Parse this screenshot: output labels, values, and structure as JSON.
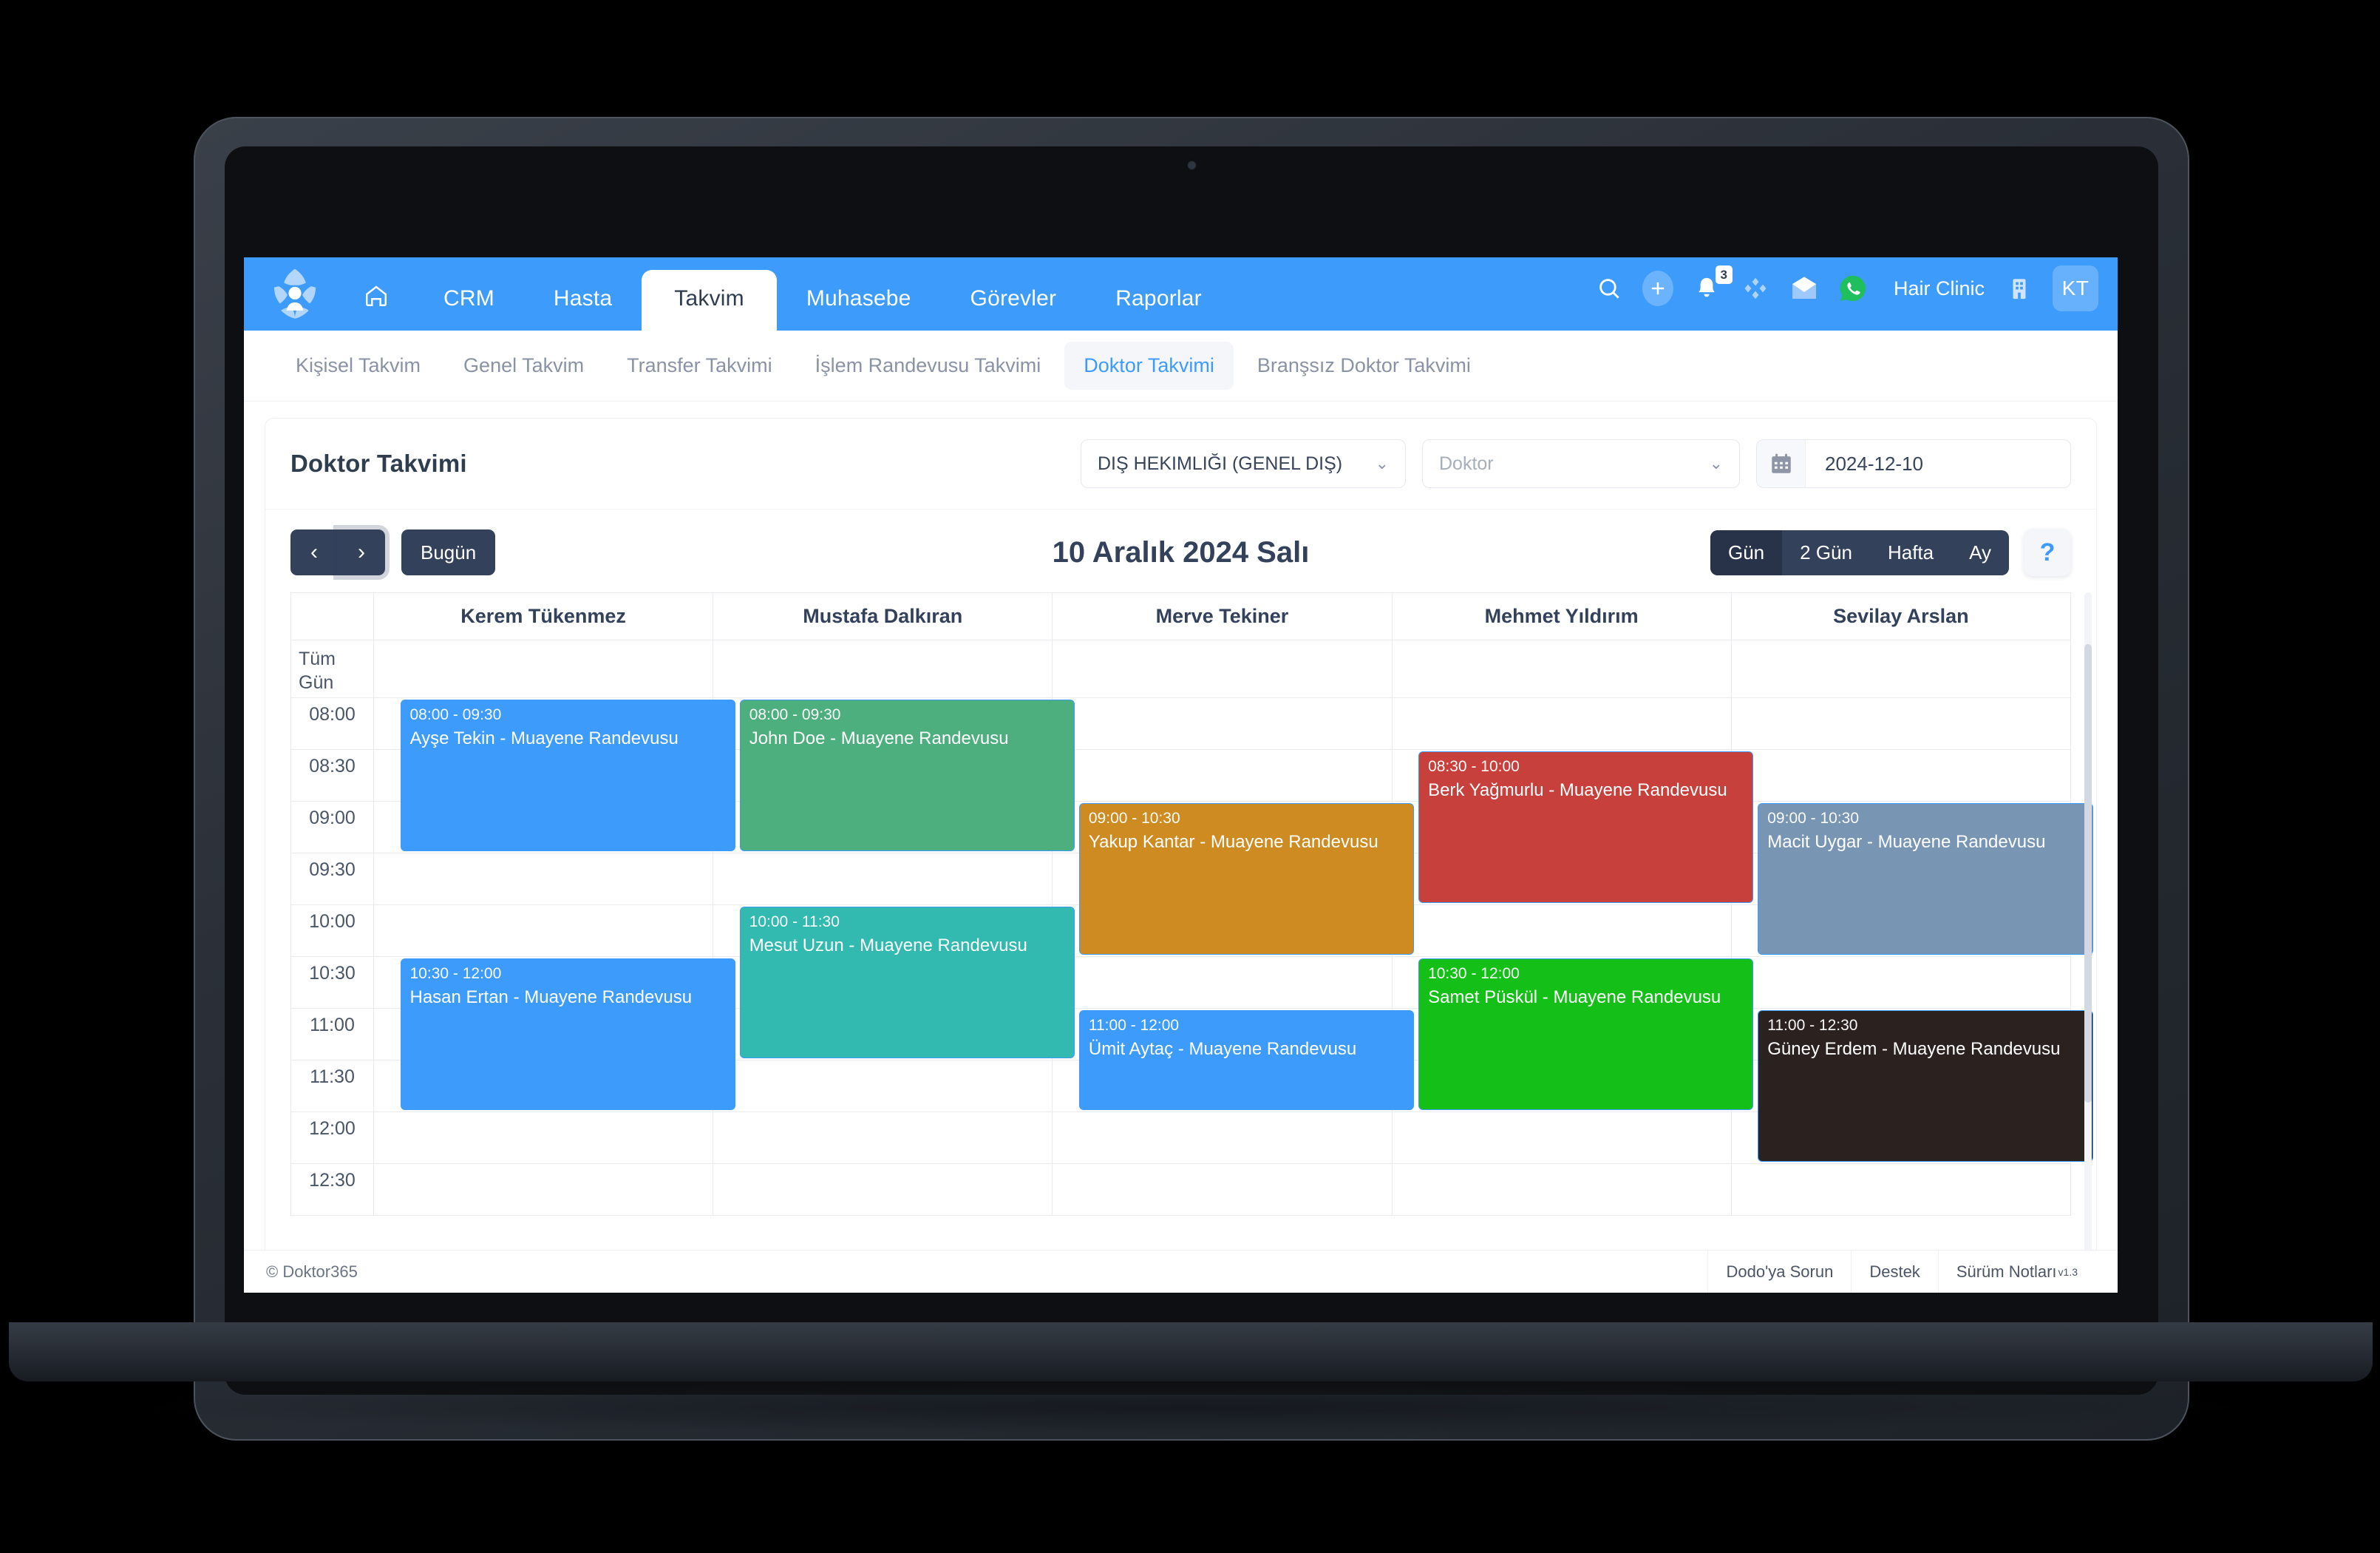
{
  "topnav": {
    "logo_name": "doktor365-logo",
    "items": [
      {
        "label": "",
        "icon": "home-icon",
        "active": false
      },
      {
        "label": "CRM",
        "active": false
      },
      {
        "label": "Hasta",
        "active": false
      },
      {
        "label": "Takvim",
        "active": true
      },
      {
        "label": "Muhasebe",
        "active": false
      },
      {
        "label": "Görevler",
        "active": false
      },
      {
        "label": "Raporlar",
        "active": false
      }
    ],
    "right": {
      "search_icon": "search-icon",
      "add_icon": "plus-icon",
      "bell_icon": "bell-icon",
      "bell_badge": "3",
      "apps_icon": "apps-diamond-icon",
      "mail_icon": "mail-icon",
      "whatsapp_icon": "whatsapp-icon",
      "clinic": "Hair Clinic",
      "building_icon": "building-icon",
      "avatar": "KT"
    },
    "accent": "#3d9bfc"
  },
  "subnav": {
    "items": [
      {
        "label": "Kişisel Takvim",
        "active": false
      },
      {
        "label": "Genel Takvim",
        "active": false
      },
      {
        "label": "Transfer Takvimi",
        "active": false
      },
      {
        "label": "İşlem Randevusu Takvimi",
        "active": false
      },
      {
        "label": "Doktor Takvimi",
        "active": true
      },
      {
        "label": "Branşsız Doktor Takvimi",
        "active": false
      }
    ]
  },
  "card": {
    "title": "Doktor Takvimi",
    "branch_select": "DIŞ HEKIMLIĞI (GENEL DIŞ)",
    "doctor_select_placeholder": "Doktor",
    "date_value": "2024-12-10",
    "calendar_icon": "calendar-icon"
  },
  "toolbar": {
    "prev_icon": "chevron-left-icon",
    "next_icon": "chevron-right-icon",
    "today_label": "Bugün",
    "date_title": "10 Aralık 2024 Salı",
    "views": [
      {
        "label": "Gün",
        "active": true
      },
      {
        "label": "2 Gün",
        "active": false
      },
      {
        "label": "Hafta",
        "active": false
      },
      {
        "label": "Ay",
        "active": false
      }
    ],
    "help_label": "?"
  },
  "calendar": {
    "allday_label_line1": "Tüm",
    "allday_label_line2": "Gün",
    "columns": [
      "Kerem Tükenmez",
      "Mustafa Dalkıran",
      "Merve Tekiner",
      "Mehmet Yıldırım",
      "Sevilay Arslan"
    ],
    "times": [
      "08:00",
      "08:30",
      "09:00",
      "09:30",
      "10:00",
      "10:30",
      "11:00",
      "11:30",
      "12:00",
      "12:30"
    ],
    "events": [
      {
        "col": 0,
        "time": "08:00 - 09:30",
        "name": "Ayşe Tekin - Muayene Randevusu",
        "color": "#3d9bfc",
        "start": "08:00",
        "end": "09:30"
      },
      {
        "col": 0,
        "time": "10:30 - 12:00",
        "name": "Hasan Ertan - Muayene Randevusu",
        "color": "#3d9bfc",
        "start": "10:30",
        "end": "12:00"
      },
      {
        "col": 1,
        "time": "08:00 - 09:30",
        "name": "John Doe - Muayene Randevusu",
        "color": "#4caf7d",
        "start": "08:00",
        "end": "09:30"
      },
      {
        "col": 1,
        "time": "10:00 - 11:30",
        "name": "Mesut Uzun - Muayene Randevusu",
        "color": "#32b9b0",
        "start": "10:00",
        "end": "11:30"
      },
      {
        "col": 2,
        "time": "09:00 - 10:30",
        "name": "Yakup Kantar - Muayene Randevusu",
        "color": "#cd8b21",
        "start": "09:00",
        "end": "10:30"
      },
      {
        "col": 2,
        "time": "11:00 - 12:00",
        "name": "Ümit Aytaç - Muayene Randevusu",
        "color": "#3d9bfc",
        "start": "11:00",
        "end": "12:00"
      },
      {
        "col": 3,
        "time": "08:30 - 10:00",
        "name": "Berk Yağmurlu - Muayene Randevusu",
        "color": "#c8403c",
        "start": "08:30",
        "end": "10:00"
      },
      {
        "col": 3,
        "time": "10:30 - 12:00",
        "name": "Samet Püskül - Muayene Randevusu",
        "color": "#14c017",
        "start": "10:30",
        "end": "12:00"
      },
      {
        "col": 4,
        "time": "09:00 - 10:30",
        "name": "Macit Uygar - Muayene Randevusu",
        "color": "#7896b4",
        "start": "09:00",
        "end": "10:30"
      },
      {
        "col": 4,
        "time": "11:00 - 12:30",
        "name": "Güney Erdem - Muayene Randevusu",
        "color": "#2b211f",
        "start": "11:00",
        "end": "12:30"
      }
    ]
  },
  "footer": {
    "copyright": "© Doktor365",
    "links": [
      {
        "label": "Dodo'ya Sorun"
      },
      {
        "label": "Destek"
      },
      {
        "label": "Sürüm Notları",
        "sup": "v1.3"
      }
    ]
  }
}
